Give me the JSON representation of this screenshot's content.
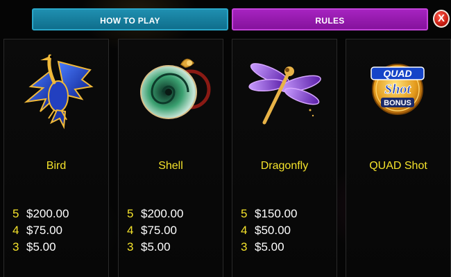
{
  "tabs": {
    "how_to_play": "HOW TO PLAY",
    "rules": "RULES"
  },
  "close_label": "X",
  "symbols": [
    {
      "name": "Bird",
      "icon": "bird-icon",
      "payouts": [
        {
          "count": "5",
          "amount": "$200.00"
        },
        {
          "count": "4",
          "amount": "$75.00"
        },
        {
          "count": "3",
          "amount": "$5.00"
        }
      ]
    },
    {
      "name": "Shell",
      "icon": "shell-icon",
      "payouts": [
        {
          "count": "5",
          "amount": "$200.00"
        },
        {
          "count": "4",
          "amount": "$75.00"
        },
        {
          "count": "3",
          "amount": "$5.00"
        }
      ]
    },
    {
      "name": "Dragonfly",
      "icon": "dragonfly-icon",
      "payouts": [
        {
          "count": "5",
          "amount": "$150.00"
        },
        {
          "count": "4",
          "amount": "$50.00"
        },
        {
          "count": "3",
          "amount": "$5.00"
        }
      ]
    },
    {
      "name": "QUAD Shot",
      "icon": "quad-shot-bonus-icon",
      "logo_text": [
        "QUAD",
        "Shot",
        "BONUS"
      ]
    }
  ],
  "colors": {
    "accent_yellow": "#f5e32b",
    "tab_blue": "#1f8fb0",
    "tab_purple": "#a623c0",
    "close_red": "#c81d12"
  }
}
